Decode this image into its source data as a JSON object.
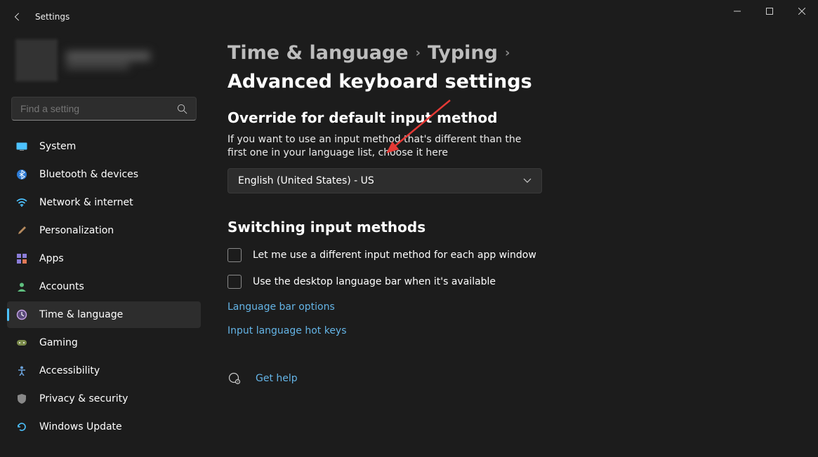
{
  "titlebar": {
    "app_title": "Settings"
  },
  "search": {
    "placeholder": "Find a setting"
  },
  "sidebar": {
    "items": [
      {
        "label": "System",
        "icon": "🖥️"
      },
      {
        "label": "Bluetooth & devices",
        "icon": "bt"
      },
      {
        "label": "Network & internet",
        "icon": "📶"
      },
      {
        "label": "Personalization",
        "icon": "🖌️"
      },
      {
        "label": "Apps",
        "icon": "▦"
      },
      {
        "label": "Accounts",
        "icon": "👤"
      },
      {
        "label": "Time & language",
        "icon": "🕒"
      },
      {
        "label": "Gaming",
        "icon": "🎮"
      },
      {
        "label": "Accessibility",
        "icon": "♿"
      },
      {
        "label": "Privacy & security",
        "icon": "🛡️"
      },
      {
        "label": "Windows Update",
        "icon": "🔄"
      }
    ]
  },
  "breadcrumb": {
    "level1": "Time & language",
    "level2": "Typing",
    "current": "Advanced keyboard settings"
  },
  "override": {
    "title": "Override for default input method",
    "desc": "If you want to use an input method that's different than the first one in your language list, choose it here",
    "selected": "English (United States) - US"
  },
  "switching": {
    "title": "Switching input methods",
    "check_per_app": "Let me use a different input method for each app window",
    "check_lang_bar": "Use the desktop language bar when it's available",
    "link_lang_bar": "Language bar options",
    "link_hotkeys": "Input language hot keys"
  },
  "help": {
    "label": "Get help"
  }
}
